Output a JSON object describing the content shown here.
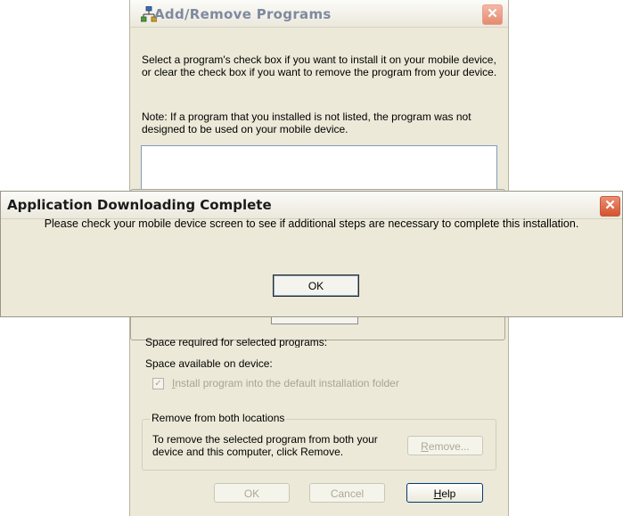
{
  "bg_window": {
    "title": "Add/Remove Programs",
    "close_glyph": "✕",
    "instructions": "Select a program's check box if you want to install it on your mobile device, or clear the check box if you want to remove the program from your device.",
    "note": "Note:  If a program that you installed is not listed, the program was not designed to be used on your mobile device.",
    "space_required_label": "Space required for selected programs:",
    "space_available_label": "Space available on device:",
    "install_default_label_first": "I",
    "install_default_label_rest": "nstall program into the default installation folder",
    "install_default_checked": true,
    "remove_group": {
      "legend": "Remove from both locations",
      "text": "To remove the selected program from both your device and this computer, click Remove.",
      "remove_button_first": "R",
      "remove_button_rest": "emove..."
    },
    "buttons": {
      "ok": "OK",
      "cancel": "Cancel",
      "help_first": "H",
      "help_rest": "elp"
    }
  },
  "dialog": {
    "title": "Application Downloading Complete",
    "message": "Please check your mobile device screen to see if additional steps are necessary to complete this installation.",
    "ok_label": "OK",
    "close_glyph": "✕"
  },
  "icons": {
    "title_icon": "programs-icon",
    "close_icon": "close-icon"
  },
  "colors": {
    "window_face": "#ece9d8",
    "dialog_close_active": "#d4532f",
    "bg_close_inactive": "#e48a70",
    "inactive_title_text": "#7f8aa0"
  }
}
